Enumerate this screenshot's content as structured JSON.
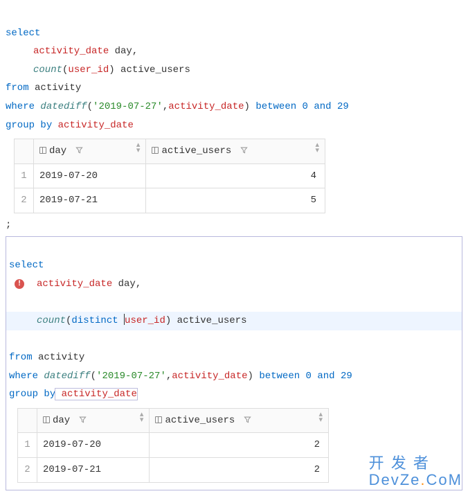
{
  "query1": {
    "l1_select": "select",
    "l2_col": "activity_date",
    "l2_alias": " day,",
    "l3_fn": "count",
    "l3_open": "(",
    "l3_arg": "user_id",
    "l3_close": ") active_users",
    "l4_from": "from",
    "l4_tbl": " activity",
    "l5_where": "where",
    "l5_fn": "datediff",
    "l5_open": "(",
    "l5_str": "'2019-07-27'",
    "l5_comma": ",",
    "l5_col": "activity_date",
    "l5_close": ") ",
    "l5_between": "between",
    "l5_n0": " 0 ",
    "l5_and": "and",
    "l5_n29": " 29",
    "l6_group": "group",
    "l6_by": " by",
    "l6_col": " activity_date"
  },
  "table1": {
    "col1": "day",
    "col2": "active_users",
    "rows": [
      {
        "n": "1",
        "day": "2019-07-20",
        "val": "4"
      },
      {
        "n": "2",
        "day": "2019-07-21",
        "val": "5"
      }
    ]
  },
  "semi": ";",
  "query2": {
    "l1_select": "select",
    "l2_col": "activity_date",
    "l2_alias": " day,",
    "l3_fn": "count",
    "l3_open": "(",
    "l3_distinct": "distinct",
    "l3_arg": "user_id",
    "l3_close": ") active_users",
    "l4_from": "from",
    "l4_tbl": " activity",
    "l5_where": "where",
    "l5_fn": "datediff",
    "l5_open": "(",
    "l5_str": "'2019-07-27'",
    "l5_comma": ",",
    "l5_col": "activity_date",
    "l5_close": ") ",
    "l5_between": "between",
    "l5_n0": " 0 ",
    "l5_and": "and",
    "l5_n29": " 29",
    "l6_group": "group",
    "l6_by": " by",
    "l6_col": " activity_date"
  },
  "table2": {
    "col1": "day",
    "col2": "active_users",
    "rows": [
      {
        "n": "1",
        "day": "2019-07-20",
        "val": "2"
      },
      {
        "n": "2",
        "day": "2019-07-21",
        "val": "2"
      }
    ]
  },
  "error_glyph": "!",
  "watermark": {
    "line1": "开 发 者",
    "line2_a": "DevZe",
    "line2_b": ".",
    "line2_c": "CoM"
  }
}
